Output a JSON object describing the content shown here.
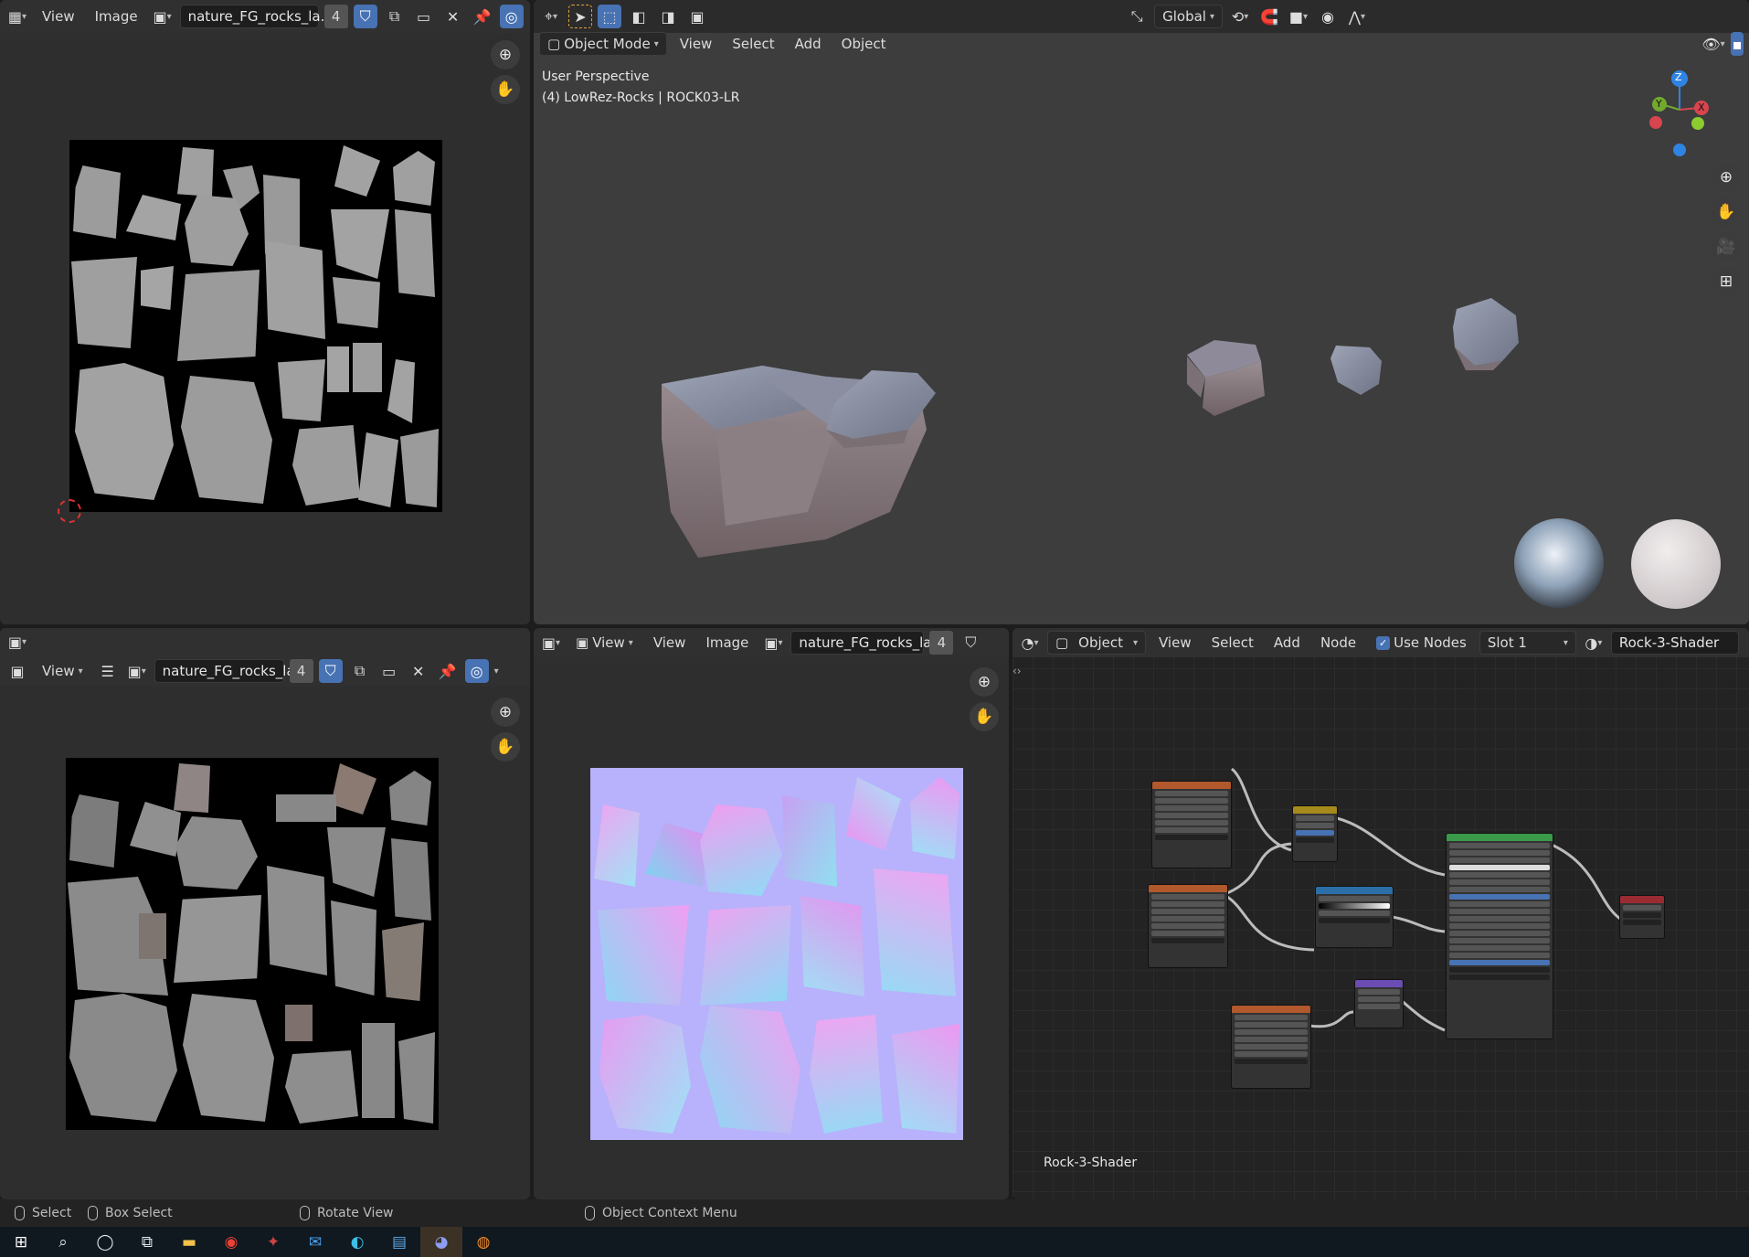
{
  "image_editor_top": {
    "menu": [
      "View",
      "Image"
    ],
    "image_name": "nature_FG_rocks_la...",
    "users": "4"
  },
  "viewport": {
    "mode": "Object Mode",
    "menu": [
      "View",
      "Select",
      "Add",
      "Object"
    ],
    "perspective_label": "User Perspective",
    "object_label": "(4) LowRez-Rocks | ROCK03-LR",
    "orientation": "Global",
    "gizmo_axes": {
      "x": "X",
      "y": "Y",
      "z": "Z"
    }
  },
  "image_editor_bottom_left": {
    "view_label": "View",
    "image_name": "nature_FG_rocks_la...",
    "users": "4"
  },
  "image_editor_bottom_mid": {
    "menu": [
      "View",
      "Image"
    ],
    "view_label": "View",
    "image_name": "nature_FG_rocks_la...",
    "users": "4"
  },
  "node_editor": {
    "object_type": "Object",
    "menu": [
      "View",
      "Select",
      "Add",
      "Node"
    ],
    "use_nodes_label": "Use Nodes",
    "slot": "Slot 1",
    "material": "Rock-3-Shader",
    "footer_material": "Rock-3-Shader"
  },
  "status_bar": {
    "select": "Select",
    "box_select": "Box Select",
    "rotate_view": "Rotate View",
    "context_menu": "Object Context Menu"
  },
  "colors": {
    "accent": "#4772b3",
    "area_bg": "#2e2e2e",
    "viewport_bg": "#3d3d3d",
    "header_bg": "#303030",
    "normal_map_bg": "#b7b2fb"
  },
  "icons": {
    "editor_type": "image-editor-icon",
    "pin": "pin-icon",
    "zoom": "zoom-icon",
    "hand": "hand-pan-icon",
    "camera": "camera-icon",
    "grid": "ortho-grid-icon"
  }
}
